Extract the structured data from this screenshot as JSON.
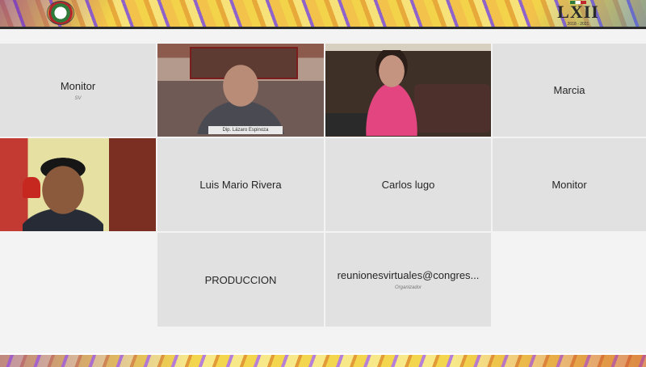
{
  "header": {
    "seal_icon": "state-seal-icon",
    "legislature_numeral": "LXII",
    "legislature_years": "2018 - 2021"
  },
  "participants": [
    {
      "name": "Monitor",
      "sub": "SV"
    },
    {
      "caption": "Dip. Lázaro Espinoza"
    },
    {
      "name": "Marcia"
    },
    {
      "name": "Luis Mario Rivera"
    },
    {
      "name": "Carlos lugo"
    },
    {
      "name": "Monitor"
    },
    {
      "name": "PRODUCCION"
    },
    {
      "name": "reunionesvirtuales@congres...",
      "sub": "Organizador"
    }
  ]
}
